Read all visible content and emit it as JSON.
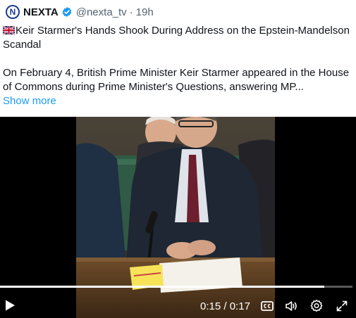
{
  "account": {
    "name": "NEXTA",
    "handle": "@nexta_tv",
    "separator": "·",
    "time": "19h",
    "avatar_letter": "N"
  },
  "post": {
    "headline": "Keir Starmer's Hands Shook During Address on the Epstein-Mandelson Scandal",
    "body": "On February 4, British Prime Minister Keir Starmer appeared in the House of Commons during Prime Minister's Questions, answering MP...",
    "show_more": "Show more"
  },
  "video": {
    "current_time": "0:15",
    "duration": "0:17",
    "time_separator": " / ",
    "progress_fraction": 0.92
  },
  "icons": {
    "flag": "uk-flag-icon",
    "verified": "verified-badge-icon",
    "play": "play-icon",
    "captions": "cc-icon",
    "volume": "volume-icon",
    "settings": "gear-icon",
    "fullscreen": "fullscreen-icon"
  },
  "colors": {
    "link": "#1d9bf0",
    "verified": "#1d9bf0",
    "secondary_text": "#536471",
    "avatar_bg": "#1d3b8f"
  }
}
